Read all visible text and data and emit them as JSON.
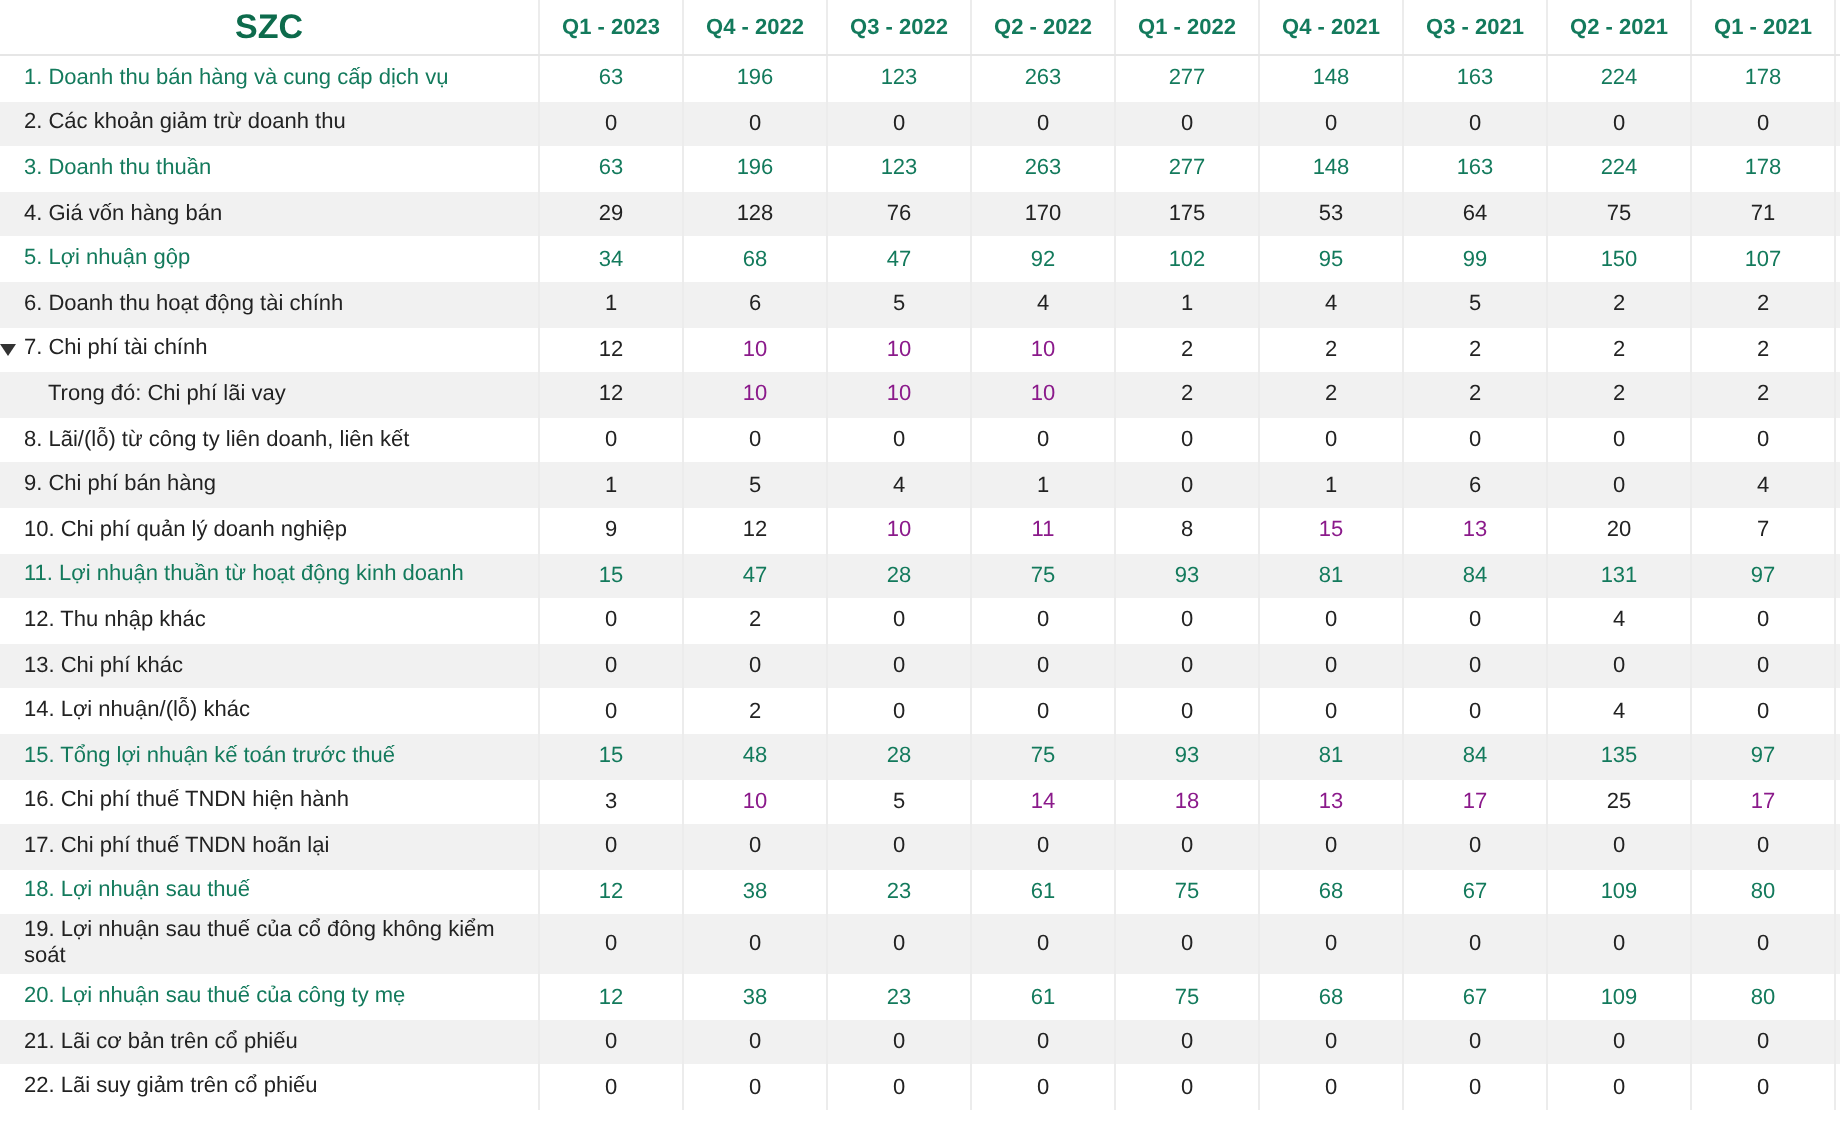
{
  "table": {
    "title": "SZC",
    "columns": [
      "Q1 - 2023",
      "Q4 - 2022",
      "Q3 - 2022",
      "Q2 - 2022",
      "Q1 - 2022",
      "Q4 - 2021",
      "Q3 - 2021",
      "Q2 - 2021",
      "Q1 - 2021"
    ],
    "rows": [
      {
        "label": "1. Doanh thu bán hàng và cung cấp dịch vụ",
        "kind": "key",
        "values": [
          "63",
          "196",
          "123",
          "263",
          "277",
          "148",
          "163",
          "224",
          "178"
        ]
      },
      {
        "label": "2. Các khoản giảm trừ doanh thu",
        "kind": "plain",
        "values": [
          "0",
          "0",
          "0",
          "0",
          "0",
          "0",
          "0",
          "0",
          "0"
        ]
      },
      {
        "label": "3. Doanh thu thuần",
        "kind": "key",
        "values": [
          "63",
          "196",
          "123",
          "263",
          "277",
          "148",
          "163",
          "224",
          "178"
        ]
      },
      {
        "label": "4. Giá vốn hàng bán",
        "kind": "plain",
        "values": [
          "29",
          "128",
          "76",
          "170",
          "175",
          "53",
          "64",
          "75",
          "71"
        ]
      },
      {
        "label": "5. Lợi nhuận gộp",
        "kind": "key",
        "values": [
          "34",
          "68",
          "47",
          "92",
          "102",
          "95",
          "99",
          "150",
          "107"
        ]
      },
      {
        "label": "6. Doanh thu hoạt động tài chính",
        "kind": "plain",
        "values": [
          "1",
          "6",
          "5",
          "4",
          "1",
          "4",
          "5",
          "2",
          "2"
        ]
      },
      {
        "label": "7. Chi phí tài chính",
        "kind": "plain",
        "expanded": true,
        "cells": [
          {
            "value": "12",
            "color": "#222222"
          },
          {
            "value": "10",
            "color": "#8b1a8b"
          },
          {
            "value": "10",
            "color": "#8b1a8b"
          },
          {
            "value": "10",
            "color": "#8b1a8b"
          },
          {
            "value": "2",
            "color": "#222222"
          },
          {
            "value": "2",
            "color": "#222222"
          },
          {
            "value": "2",
            "color": "#222222"
          },
          {
            "value": "2",
            "color": "#222222"
          },
          {
            "value": "2",
            "color": "#222222"
          }
        ],
        "children": [
          {
            "label": "Trong đó: Chi phí lãi vay",
            "cells": [
              {
                "value": "12",
                "color": "#222222"
              },
              {
                "value": "10",
                "color": "#8b1a8b"
              },
              {
                "value": "10",
                "color": "#8b1a8b"
              },
              {
                "value": "10",
                "color": "#8b1a8b"
              },
              {
                "value": "2",
                "color": "#222222"
              },
              {
                "value": "2",
                "color": "#222222"
              },
              {
                "value": "2",
                "color": "#222222"
              },
              {
                "value": "2",
                "color": "#222222"
              },
              {
                "value": "2",
                "color": "#222222"
              }
            ]
          }
        ]
      },
      {
        "label": "8. Lãi/(lỗ) từ công ty liên doanh, liên kết",
        "kind": "plain",
        "values": [
          "0",
          "0",
          "0",
          "0",
          "0",
          "0",
          "0",
          "0",
          "0"
        ]
      },
      {
        "label": "9. Chi phí bán hàng",
        "kind": "plain",
        "values": [
          "1",
          "5",
          "4",
          "1",
          "0",
          "1",
          "6",
          "0",
          "4"
        ]
      },
      {
        "label": "10. Chi phí quản lý doanh nghiệp",
        "kind": "plain",
        "cells": [
          {
            "value": "9",
            "color": "#222222"
          },
          {
            "value": "12",
            "color": "#222222"
          },
          {
            "value": "10",
            "color": "#8b1a8b"
          },
          {
            "value": "11",
            "color": "#8b1a8b"
          },
          {
            "value": "8",
            "color": "#222222"
          },
          {
            "value": "15",
            "color": "#8b1a8b"
          },
          {
            "value": "13",
            "color": "#8b1a8b"
          },
          {
            "value": "20",
            "color": "#222222"
          },
          {
            "value": "7",
            "color": "#222222"
          }
        ]
      },
      {
        "label": "11. Lợi nhuận thuần từ hoạt động kinh doanh",
        "kind": "key",
        "values": [
          "15",
          "47",
          "28",
          "75",
          "93",
          "81",
          "84",
          "131",
          "97"
        ]
      },
      {
        "label": "12. Thu nhập khác",
        "kind": "plain",
        "values": [
          "0",
          "2",
          "0",
          "0",
          "0",
          "0",
          "0",
          "4",
          "0"
        ]
      },
      {
        "label": "13. Chi phí khác",
        "kind": "plain",
        "values": [
          "0",
          "0",
          "0",
          "0",
          "0",
          "0",
          "0",
          "0",
          "0"
        ]
      },
      {
        "label": "14. Lợi nhuận/(lỗ) khác",
        "kind": "plain",
        "values": [
          "0",
          "2",
          "0",
          "0",
          "0",
          "0",
          "0",
          "4",
          "0"
        ]
      },
      {
        "label": "15. Tổng lợi nhuận kế toán trước thuế",
        "kind": "key",
        "values": [
          "15",
          "48",
          "28",
          "75",
          "93",
          "81",
          "84",
          "135",
          "97"
        ]
      },
      {
        "label": "16. Chi phí thuế TNDN hiện hành",
        "kind": "plain",
        "cells": [
          {
            "value": "3",
            "color": "#222222"
          },
          {
            "value": "10",
            "color": "#8b1a8b"
          },
          {
            "value": "5",
            "color": "#222222"
          },
          {
            "value": "14",
            "color": "#8b1a8b"
          },
          {
            "value": "18",
            "color": "#8b1a8b"
          },
          {
            "value": "13",
            "color": "#8b1a8b"
          },
          {
            "value": "17",
            "color": "#8b1a8b"
          },
          {
            "value": "25",
            "color": "#222222"
          },
          {
            "value": "17",
            "color": "#8b1a8b"
          }
        ]
      },
      {
        "label": "17. Chi phí thuế TNDN hoãn lại",
        "kind": "plain",
        "values": [
          "0",
          "0",
          "0",
          "0",
          "0",
          "0",
          "0",
          "0",
          "0"
        ]
      },
      {
        "label": "18. Lợi nhuận sau thuế",
        "kind": "key",
        "values": [
          "12",
          "38",
          "23",
          "61",
          "75",
          "68",
          "67",
          "109",
          "80"
        ]
      },
      {
        "label": "19. Lợi nhuận sau thuế của cổ đông không kiểm soát",
        "kind": "plain",
        "values": [
          "0",
          "0",
          "0",
          "0",
          "0",
          "0",
          "0",
          "0",
          "0"
        ]
      },
      {
        "label": "20. Lợi nhuận sau thuế của công ty mẹ",
        "kind": "key",
        "values": [
          "12",
          "38",
          "23",
          "61",
          "75",
          "68",
          "67",
          "109",
          "80"
        ]
      },
      {
        "label": "21. Lãi cơ bản trên cổ phiếu",
        "kind": "plain",
        "values": [
          "0",
          "0",
          "0",
          "0",
          "0",
          "0",
          "0",
          "0",
          "0"
        ]
      },
      {
        "label": "22. Lãi suy giảm trên cổ phiếu",
        "kind": "plain",
        "values": [
          "0",
          "0",
          "0",
          "0",
          "0",
          "0",
          "0",
          "0",
          "0"
        ]
      }
    ]
  }
}
